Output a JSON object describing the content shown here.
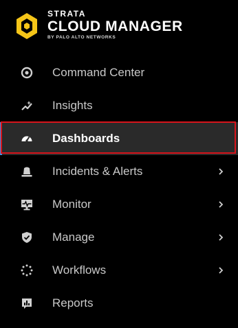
{
  "brand": {
    "line1": "STRATA",
    "line2": "CLOUD MANAGER",
    "byline": "BY PALO ALTO NETWORKS",
    "logo_color": "#f5c518"
  },
  "nav": {
    "items": [
      {
        "label": "Command Center",
        "icon": "target-icon",
        "has_submenu": false,
        "active": false
      },
      {
        "label": "Insights",
        "icon": "sparkle-trend-icon",
        "has_submenu": false,
        "active": false
      },
      {
        "label": "Dashboards",
        "icon": "gauge-icon",
        "has_submenu": false,
        "active": true
      },
      {
        "label": "Incidents & Alerts",
        "icon": "siren-icon",
        "has_submenu": true,
        "active": false
      },
      {
        "label": "Monitor",
        "icon": "monitor-pulse-icon",
        "has_submenu": true,
        "active": false
      },
      {
        "label": "Manage",
        "icon": "shield-check-icon",
        "has_submenu": true,
        "active": false
      },
      {
        "label": "Workflows",
        "icon": "dotted-circle-icon",
        "has_submenu": true,
        "active": false
      },
      {
        "label": "Reports",
        "icon": "report-chart-icon",
        "has_submenu": false,
        "active": false
      }
    ]
  },
  "colors": {
    "background": "#000000",
    "active_background": "#2a2a2a",
    "active_indicator": "#4a8fe0",
    "highlight_border": "#d8141b",
    "text": "#c9c9c9",
    "text_active": "#ffffff"
  }
}
